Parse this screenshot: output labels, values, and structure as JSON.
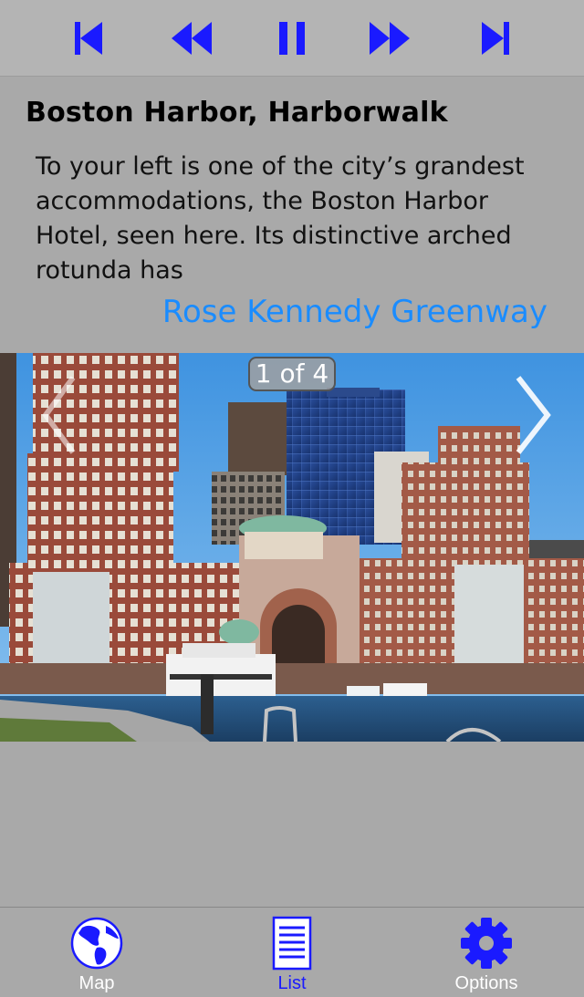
{
  "toolbar": {
    "buttons": [
      {
        "name": "skip-back-icon"
      },
      {
        "name": "rewind-icon"
      },
      {
        "name": "pause-icon"
      },
      {
        "name": "fast-forward-icon"
      },
      {
        "name": "skip-forward-icon"
      }
    ],
    "icon_color": "#1a1aff"
  },
  "stop": {
    "title": "Boston Harbor, Harborwalk",
    "description": "To your left is one of the city’s grandest accommodations, the Boston Harbor Hotel, seen here. Its distinctive arched rotunda has",
    "next_link": "Rose Kennedy Greenway"
  },
  "gallery": {
    "counter": "1 of 4",
    "prev_icon": "chevron-left-icon",
    "next_icon": "chevron-right-icon"
  },
  "tabs": [
    {
      "label": "Map",
      "icon": "globe-icon",
      "active": false
    },
    {
      "label": "List",
      "icon": "list-icon",
      "active": true
    },
    {
      "label": "Options",
      "icon": "gear-icon",
      "active": false
    }
  ],
  "colors": {
    "background": "#a9a9a9",
    "link": "#1a8cff",
    "accent": "#1a1aff"
  }
}
